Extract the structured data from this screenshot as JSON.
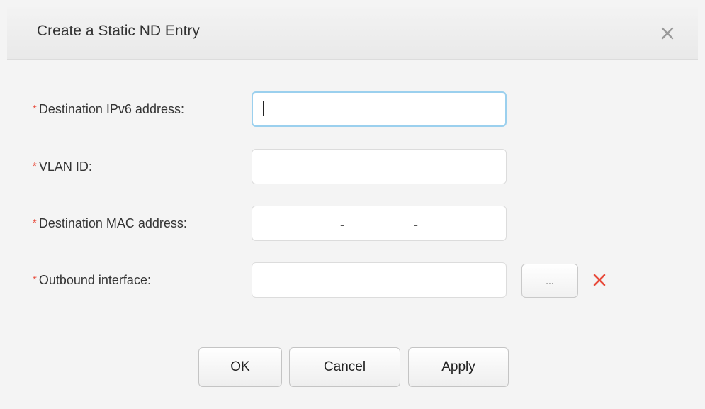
{
  "dialog": {
    "title": "Create a Static ND Entry",
    "close_glyph": "✕"
  },
  "form": {
    "required_marker": "*",
    "fields": [
      {
        "label": "Destination IPv6 address:",
        "value": "",
        "focused": true
      },
      {
        "label": "VLAN ID:",
        "value": ""
      },
      {
        "label": "Destination MAC address:",
        "separator": "-",
        "segments": [
          "",
          "",
          ""
        ]
      },
      {
        "label": "Outbound interface:",
        "value": "",
        "browse_label": "...",
        "clear_icon": "close-icon",
        "clear_color": "#e84a3a"
      }
    ]
  },
  "footer": {
    "ok_label": "OK",
    "cancel_label": "Cancel",
    "apply_label": "Apply"
  },
  "colors": {
    "required": "#e84a3a",
    "focus_border": "#9bd0ee",
    "background": "#f4f4f4"
  }
}
